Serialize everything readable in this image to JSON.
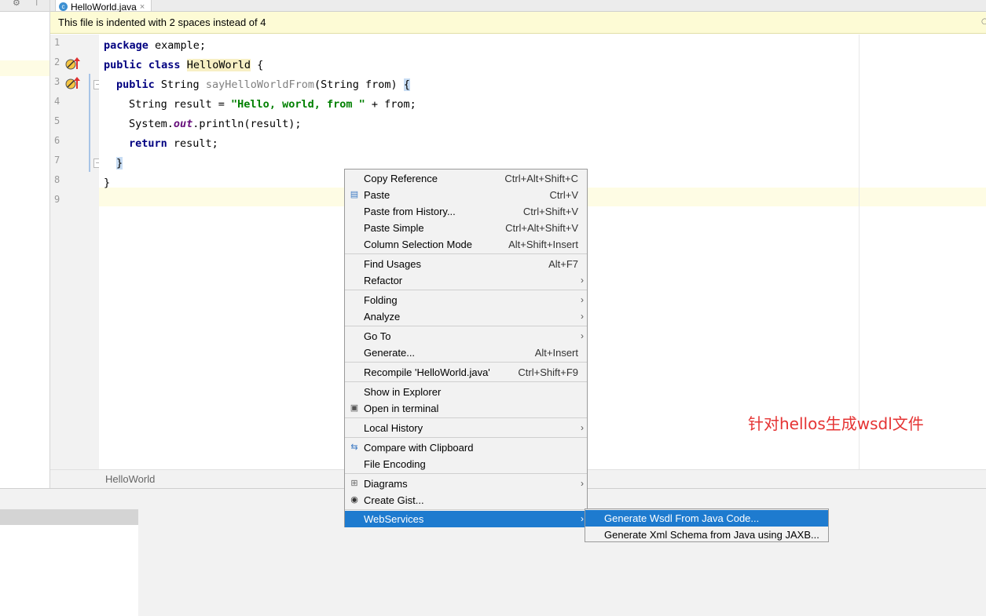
{
  "top_left": {
    "gear": "⚙",
    "pin": "⊤"
  },
  "tab": {
    "label": "HelloWorld.java",
    "close": "×",
    "icon": "c-class-icon",
    "icon_letter": "c"
  },
  "notification": {
    "text": "This file is indented with 2 spaces instead of 4"
  },
  "editor": {
    "line_numbers": [
      "1",
      "2",
      "3",
      "4",
      "5",
      "6",
      "7",
      "8",
      "9"
    ],
    "lines": {
      "l1": {
        "kw": "package",
        "rest": " example;"
      },
      "l2": {
        "kw1": "public",
        "kw2": "class",
        "name": "HelloWorld",
        "rest": " {"
      },
      "l3": {
        "kw": "public",
        "type": " String ",
        "method": "sayHelloWorldFrom",
        "params": "(String from) ",
        "brace": "{"
      },
      "l4": {
        "pre": "String result = ",
        "str": "\"Hello, world, from \"",
        "post": " + from;"
      },
      "l5": {
        "pre": "System.",
        "field": "out",
        "post": ".println(result);"
      },
      "l6": {
        "kw": "return",
        "rest": " result;"
      },
      "l7": {
        "brace": "}"
      },
      "l8": {
        "brace": "}"
      }
    }
  },
  "breadcrumb": {
    "text": "HelloWorld"
  },
  "context_menu": {
    "items": [
      {
        "label": "Copy Reference",
        "shortcut": "Ctrl+Alt+Shift+C"
      },
      {
        "label": "Paste",
        "shortcut": "Ctrl+V",
        "icon": "clipboard-icon"
      },
      {
        "label": "Paste from History...",
        "shortcut": "Ctrl+Shift+V"
      },
      {
        "label": "Paste Simple",
        "shortcut": "Ctrl+Alt+Shift+V"
      },
      {
        "label": "Column Selection Mode",
        "shortcut": "Alt+Shift+Insert"
      },
      {
        "label": "Find Usages",
        "shortcut": "Alt+F7"
      },
      {
        "label": "Refactor",
        "submenu": true
      },
      {
        "label": "Folding",
        "submenu": true
      },
      {
        "label": "Analyze",
        "submenu": true
      },
      {
        "label": "Go To",
        "submenu": true
      },
      {
        "label": "Generate...",
        "shortcut": "Alt+Insert"
      },
      {
        "label": "Recompile 'HelloWorld.java'",
        "shortcut": "Ctrl+Shift+F9"
      },
      {
        "label": "Show in Explorer"
      },
      {
        "label": "Open in terminal",
        "icon": "terminal-icon"
      },
      {
        "label": "Local History",
        "submenu": true
      },
      {
        "label": "Compare with Clipboard",
        "icon": "compare-icon"
      },
      {
        "label": "File Encoding"
      },
      {
        "label": "Diagrams",
        "submenu": true,
        "icon": "diagram-icon"
      },
      {
        "label": "Create Gist...",
        "icon": "github-icon"
      },
      {
        "label": "WebServices",
        "submenu": true,
        "selected": true
      }
    ],
    "arrow": "›"
  },
  "submenu": {
    "items": [
      {
        "label": "Generate Wsdl From Java Code...",
        "selected": true
      },
      {
        "label": "Generate Xml Schema from Java using JAXB..."
      }
    ]
  },
  "annotation": {
    "text": "针对hellos生成wsdl文件",
    "color": "#e53333"
  },
  "colors": {
    "selection": "#1e7bcf",
    "notice_bg": "#fdfbd5",
    "caret_row": "#fefce4"
  }
}
